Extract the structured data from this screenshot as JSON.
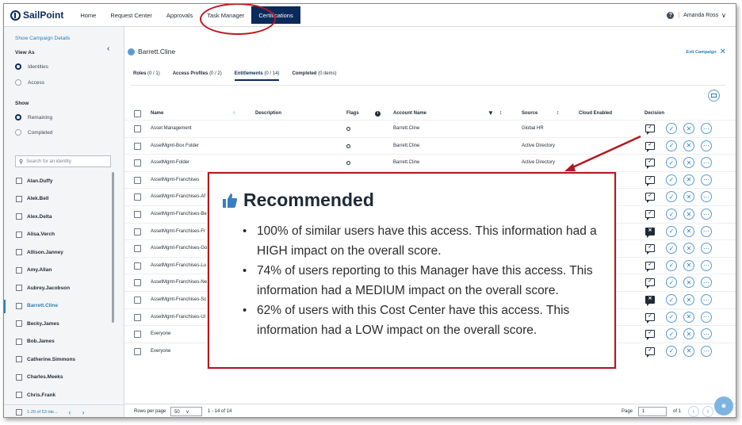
{
  "topnav": {
    "logo": "SailPoint",
    "items": [
      "Home",
      "Request Center",
      "Approvals",
      "Task Manager",
      "Certifications"
    ],
    "active_item": "Certifications",
    "help": "?",
    "user": "Amanda Ross"
  },
  "sidebar": {
    "show_details": "Show Campaign Details",
    "view_as_label": "View As",
    "view_as_options": [
      "Identities",
      "Access"
    ],
    "show_label": "Show",
    "show_options": [
      "Remaining",
      "Completed"
    ],
    "search_placeholder": "Search for an identity",
    "identities": [
      "Alan.Duffy",
      "Alek.Bell",
      "Alex.Delta",
      "Alisa.Verch",
      "Allison.Janney",
      "Amy.Allan",
      "Aubrey.Jacobson",
      "Barrett.Cline",
      "Becky.James",
      "Bob.James",
      "Catherine.Simmons",
      "Charles.Meeks",
      "Chris.Frank"
    ],
    "selected_identity": "Barrett.Cline",
    "footer_range": "1-20 of 53 Ide..."
  },
  "main": {
    "user": "Barrett.Cline",
    "exit": "Exit Campaign",
    "tabs": [
      {
        "label": "Roles",
        "count": "(0 / 1)"
      },
      {
        "label": "Access Profiles",
        "count": "(0 / 2)"
      },
      {
        "label": "Entitlements",
        "count": "(0 / 14)"
      },
      {
        "label": "Completed",
        "count": "(0 items)"
      }
    ],
    "columns": {
      "name": "Name",
      "description": "Description",
      "flags": "Flags",
      "account": "Account Name",
      "source": "Source",
      "cloud": "Cloud Enabled",
      "decision": "Decision"
    },
    "rows": [
      {
        "name": "Asset Management",
        "account": "Barrett.Cline",
        "source": "Global HR",
        "flag": true,
        "comment_dark": false
      },
      {
        "name": "AssetMgmt-Box Folder",
        "account": "Barrett.Cline",
        "source": "Active Directory",
        "flag": true,
        "comment_dark": false
      },
      {
        "name": "AssetMgmt-Folder",
        "account": "Barrett.Cline",
        "source": "Active Directory",
        "flag": true,
        "comment_dark": false
      },
      {
        "name": "AssetMgmt-Franchises",
        "account": "",
        "source": "",
        "flag": false,
        "comment_dark": false
      },
      {
        "name": "AssetMgmt-Franchises-Af",
        "account": "",
        "source": "",
        "flag": false,
        "comment_dark": false
      },
      {
        "name": "AssetMgmt-Franchises-Be",
        "account": "",
        "source": "",
        "flag": false,
        "comment_dark": false
      },
      {
        "name": "AssetMgmt-Franchises-Fr",
        "account": "",
        "source": "",
        "flag": false,
        "comment_dark": true
      },
      {
        "name": "AssetMgmt-Franchises-Go",
        "account": "",
        "source": "",
        "flag": false,
        "comment_dark": false
      },
      {
        "name": "AssetMgmt-Franchises-Lu",
        "account": "",
        "source": "",
        "flag": false,
        "comment_dark": false
      },
      {
        "name": "AssetMgmt-Franchises-Ne",
        "account": "",
        "source": "",
        "flag": false,
        "comment_dark": false
      },
      {
        "name": "AssetMgmt-Franchises-Sc",
        "account": "",
        "source": "",
        "flag": false,
        "comment_dark": true
      },
      {
        "name": "AssetMgmt-Franchises-Ul",
        "account": "",
        "source": "",
        "flag": false,
        "comment_dark": false
      },
      {
        "name": "Everyone",
        "account": "",
        "source": "",
        "flag": false,
        "comment_dark": false
      },
      {
        "name": "Everyone",
        "account": "",
        "source": "",
        "flag": false,
        "comment_dark": false
      }
    ],
    "footer": {
      "rows_per_page_label": "Rows per page",
      "rows_per_page": "50",
      "range": "1 - 14 of 14",
      "page_label": "Page",
      "page": "1",
      "of": "of 1"
    }
  },
  "callout": {
    "title": "Recommended",
    "bullets": [
      "100% of similar users have this access. This information had a HIGH impact on the overall score.",
      "74% of users reporting to this Manager have this access. This information had a MEDIUM impact on the overall score.",
      "62% of users with this Cost Center have this access. This information had a LOW impact on the overall score."
    ]
  },
  "colors": {
    "brand": "#0b2a5c",
    "accent": "#2a7fb8",
    "highlight": "#c0141c"
  }
}
